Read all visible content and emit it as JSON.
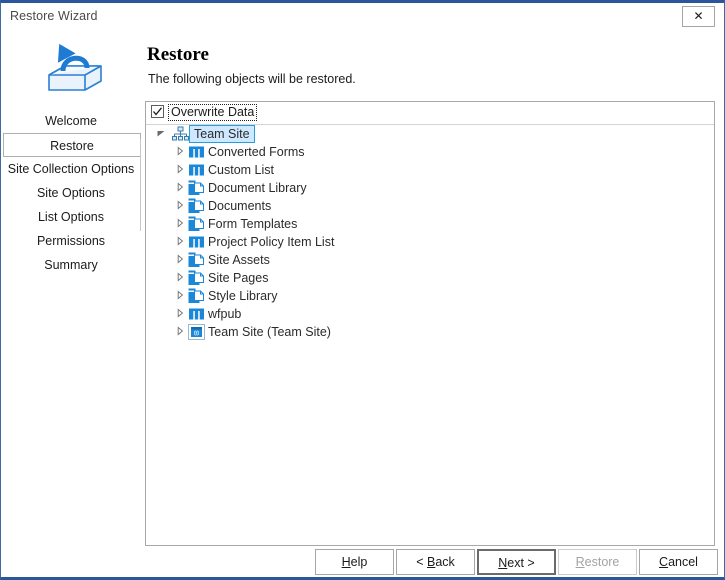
{
  "window": {
    "title": "Restore Wizard",
    "close_label": "✕",
    "accent_color": "#2b579a"
  },
  "header": {
    "icon": "restore-box-arrow-icon",
    "title": "Restore",
    "subtitle": "The following objects will be restored."
  },
  "sidebar": {
    "items": [
      {
        "label": "Welcome",
        "selected": false
      },
      {
        "label": "Restore",
        "selected": true
      },
      {
        "label": "Site Collection Options",
        "selected": false
      },
      {
        "label": "Site Options",
        "selected": false
      },
      {
        "label": "List Options",
        "selected": false
      },
      {
        "label": "Permissions",
        "selected": false
      },
      {
        "label": "Summary",
        "selected": false
      }
    ]
  },
  "panel": {
    "overwrite": {
      "label": "Overwrite Data",
      "checked": true,
      "focused": true
    },
    "tree": [
      {
        "label": "Team Site",
        "icon": "site-hierarchy-icon",
        "level": 0,
        "expanded": true,
        "selected": true
      },
      {
        "label": "Converted Forms",
        "icon": "list-icon",
        "level": 1,
        "expanded": false,
        "selected": false
      },
      {
        "label": "Custom List",
        "icon": "list-icon",
        "level": 1,
        "expanded": false,
        "selected": false
      },
      {
        "label": "Document Library",
        "icon": "document-library-icon",
        "level": 1,
        "expanded": false,
        "selected": false
      },
      {
        "label": "Documents",
        "icon": "document-library-icon",
        "level": 1,
        "expanded": false,
        "selected": false
      },
      {
        "label": "Form Templates",
        "icon": "document-library-icon",
        "level": 1,
        "expanded": false,
        "selected": false
      },
      {
        "label": "Project Policy Item List",
        "icon": "list-icon",
        "level": 1,
        "expanded": false,
        "selected": false
      },
      {
        "label": "Site Assets",
        "icon": "document-library-icon",
        "level": 1,
        "expanded": false,
        "selected": false
      },
      {
        "label": "Site Pages",
        "icon": "document-library-icon",
        "level": 1,
        "expanded": false,
        "selected": false
      },
      {
        "label": "Style Library",
        "icon": "document-library-icon",
        "level": 1,
        "expanded": false,
        "selected": false
      },
      {
        "label": "wfpub",
        "icon": "list-icon",
        "level": 1,
        "expanded": false,
        "selected": false
      },
      {
        "label": "Team Site (Team Site)",
        "icon": "subsite-icon",
        "level": 1,
        "expanded": false,
        "selected": false
      }
    ]
  },
  "footer": {
    "buttons": [
      {
        "id": "help",
        "text_before": "",
        "mnemonic": "H",
        "text_after": "elp",
        "disabled": false,
        "default": false
      },
      {
        "id": "back",
        "text_before": "< ",
        "mnemonic": "B",
        "text_after": "ack",
        "disabled": false,
        "default": false
      },
      {
        "id": "next",
        "text_before": "",
        "mnemonic": "N",
        "text_after": "ext >",
        "disabled": false,
        "default": true
      },
      {
        "id": "restore",
        "text_before": "",
        "mnemonic": "R",
        "text_after": "estore",
        "disabled": true,
        "default": false
      },
      {
        "id": "cancel",
        "text_before": "",
        "mnemonic": "C",
        "text_after": "ancel",
        "disabled": false,
        "default": false
      }
    ]
  }
}
